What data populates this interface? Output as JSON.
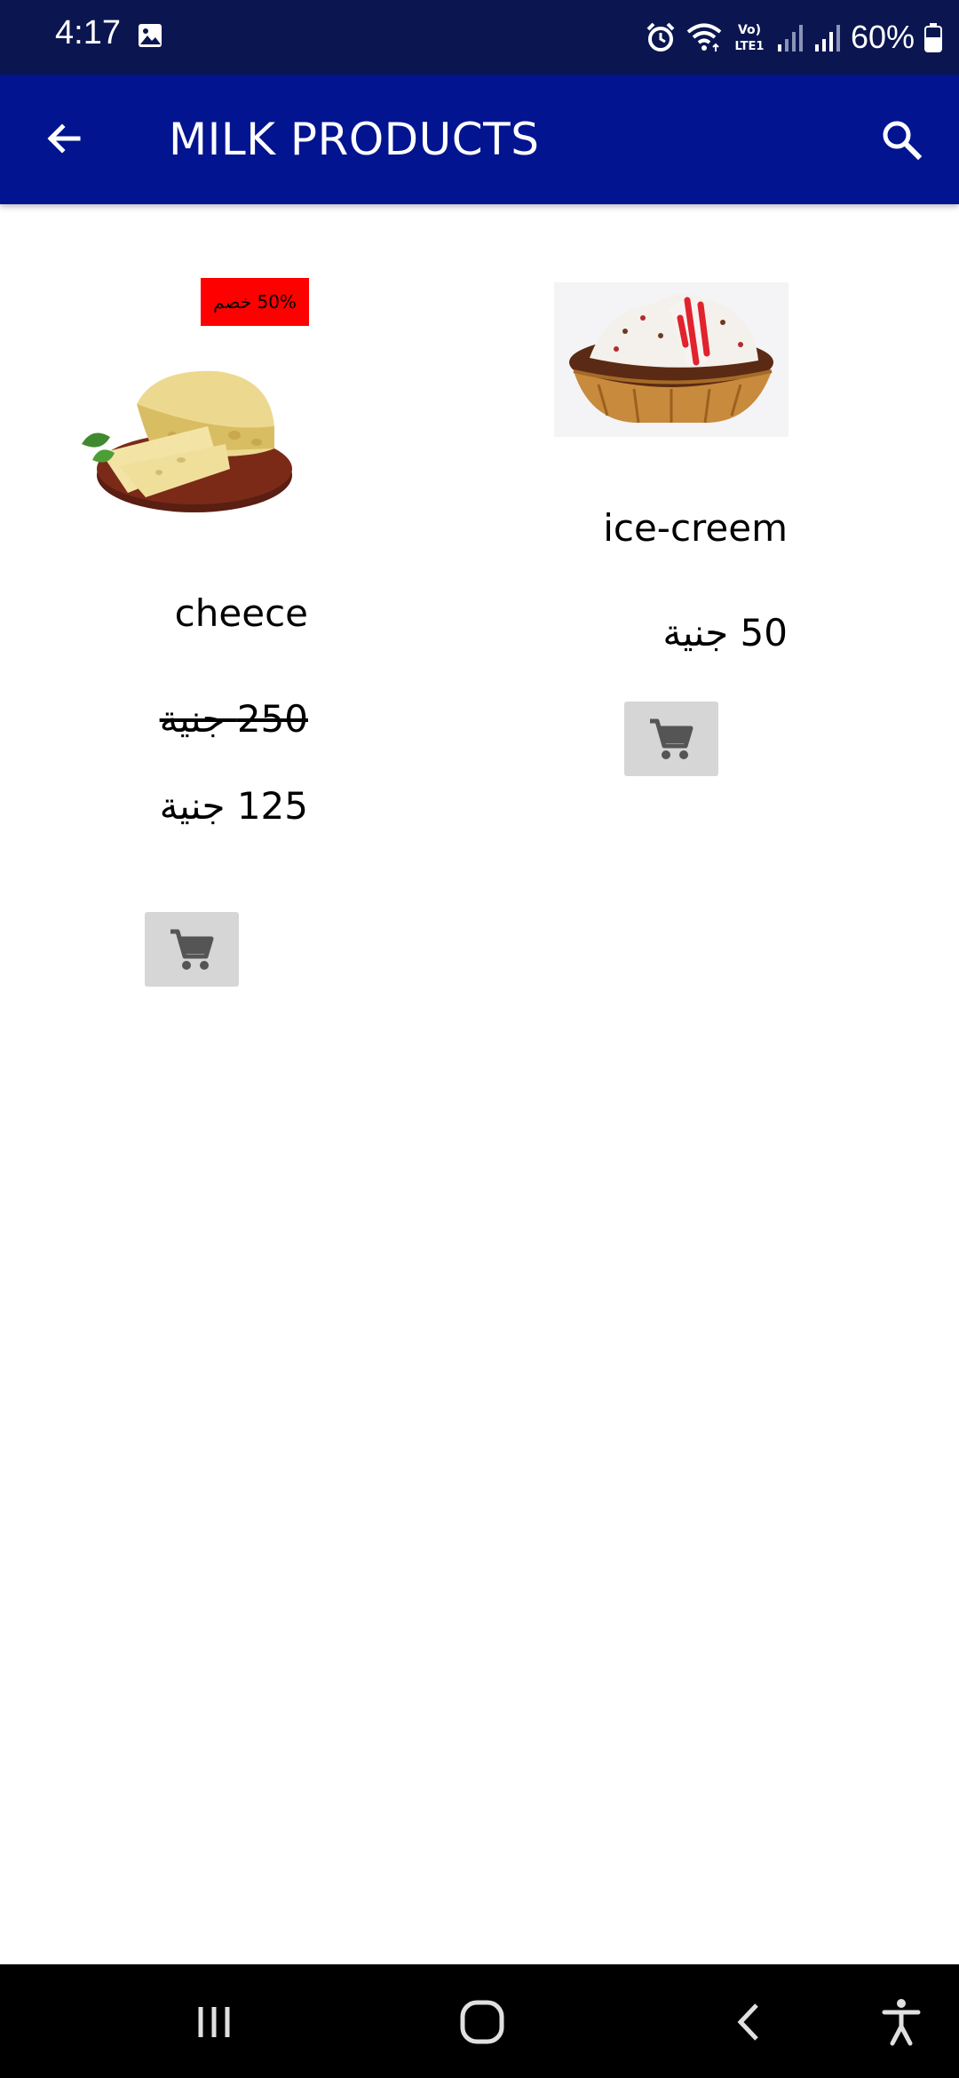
{
  "status_bar": {
    "time": "4:17",
    "battery": "60%",
    "icons": [
      "gallery-icon",
      "alarm-icon",
      "wifi-icon",
      "volte-icon",
      "signal-icon",
      "signal-icon",
      "battery-icon"
    ]
  },
  "app_bar": {
    "title": "MILK PRODUCTS",
    "back_icon": "arrow-back-icon",
    "search_icon": "search-icon",
    "background": "#021490"
  },
  "products": [
    {
      "name": "cheece",
      "image": "cheese-image",
      "discount_badge": "50% خصم",
      "old_price": "250 جنية",
      "price": "125 جنية",
      "cart_icon": "cart-icon"
    },
    {
      "name": "ice-creem",
      "image": "ice-cream-image",
      "price": "50 جنية",
      "cart_icon": "cart-icon"
    }
  ],
  "nav_bar": {
    "icons": [
      "recent-apps-icon",
      "home-icon",
      "back-icon",
      "accessibility-icon"
    ]
  },
  "colors": {
    "status_bar": "#0b1650",
    "app_bar": "#021490",
    "badge": "#ff0000",
    "cart_button": "#d6d6d6"
  }
}
